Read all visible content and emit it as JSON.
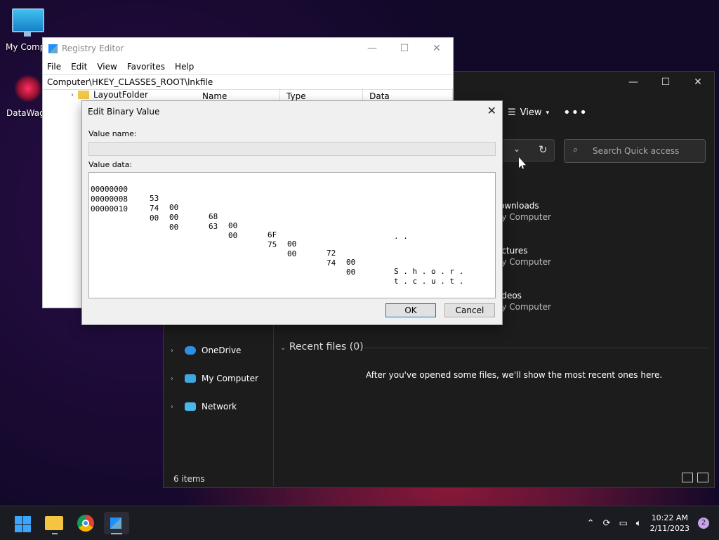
{
  "desktop": {
    "icons": [
      {
        "label": "My Compu"
      },
      {
        "label": "DataWago"
      }
    ]
  },
  "explorer": {
    "toolbar": {
      "view_label": "View"
    },
    "search_placeholder": "Search Quick access",
    "quick_access": [
      {
        "title": "ownloads",
        "subtitle": "ly Computer"
      },
      {
        "title": "ictures",
        "subtitle": "ly Computer"
      },
      {
        "title": "ideos",
        "subtitle": "ly Computer"
      }
    ],
    "nav": [
      {
        "label": "OneDrive"
      },
      {
        "label": "My Computer"
      },
      {
        "label": "Network"
      }
    ],
    "recent_header": "Recent files (0)",
    "recent_message": "After you've opened some files, we'll show the most recent ones here.",
    "status": "6 items"
  },
  "regedit": {
    "title": "Registry Editor",
    "menu": [
      "File",
      "Edit",
      "View",
      "Favorites",
      "Help"
    ],
    "address": "Computer\\HKEY_CLASSES_ROOT\\lnkfile",
    "tree_top": "LayoutFolder",
    "columns": [
      "Name",
      "Type",
      "Data"
    ]
  },
  "dialog": {
    "title": "Edit Binary Value",
    "value_name_label": "Value name:",
    "value_name": "",
    "value_data_label": "Value data:",
    "rows": [
      {
        "offset": "00000000",
        "bytes": [
          "53",
          "00",
          "68",
          "00",
          "6F",
          "00",
          "72",
          "00"
        ],
        "ascii": "S . h . o . r ."
      },
      {
        "offset": "00000008",
        "bytes": [
          "74",
          "00",
          "63",
          "00",
          "75",
          "00",
          "74",
          "00"
        ],
        "ascii": "t . c . u . t ."
      },
      {
        "offset": "00000010",
        "bytes": [
          "00",
          "00"
        ],
        "ascii": ". ."
      }
    ],
    "ok_label": "OK",
    "cancel_label": "Cancel"
  },
  "taskbar": {
    "time": "10:22 AM",
    "date": "2/11/2023",
    "notification_count": "2"
  }
}
